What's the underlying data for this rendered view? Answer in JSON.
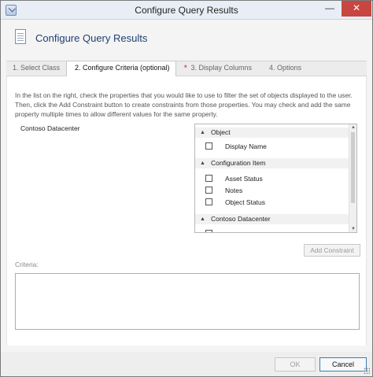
{
  "window": {
    "title": "Configure Query Results",
    "minimize_glyph": "—",
    "close_glyph": "✕"
  },
  "header": {
    "title": "Configure Query Results"
  },
  "tabs": [
    {
      "label": "1. Select Class",
      "active": false,
      "required": false
    },
    {
      "label": "2. Configure Criteria (optional)",
      "active": true,
      "required": false
    },
    {
      "label": "3. Display Columns",
      "active": false,
      "required": true
    },
    {
      "label": "4. Options",
      "active": false,
      "required": false
    }
  ],
  "content": {
    "description": "In the list on the right, check the properties that you would like to use to filter the set of objects displayed to the user. Then, click the Add Constraint button to create constraints from those properties. You may check and add the same property multiple times to allow different values for the same property.",
    "class_label": "Contoso Datacenter",
    "groups": [
      {
        "name": "Object",
        "properties": [
          {
            "label": "Display Name",
            "checked": false
          }
        ]
      },
      {
        "name": "Configuration Item",
        "properties": [
          {
            "label": "Asset Status",
            "checked": false
          },
          {
            "label": "Notes",
            "checked": false
          },
          {
            "label": "Object Status",
            "checked": false
          }
        ]
      },
      {
        "name": "Contoso Datacenter",
        "properties": []
      }
    ],
    "add_constraint_label": "Add Constraint",
    "criteria_label": "Criteria:",
    "criteria_value": ""
  },
  "footer": {
    "ok_label": "OK",
    "cancel_label": "Cancel"
  },
  "colors": {
    "accent": "#1f3f73",
    "close_button": "#c7463f",
    "required_star": "#e0463a",
    "focus_border": "#3c7fb1"
  },
  "icons": {
    "system": "window-system-icon",
    "header": "document-icon",
    "collapse": "chevron-up-icon",
    "scroll_up": "scroll-up-arrow-icon",
    "scroll_down": "scroll-down-arrow-icon",
    "grip": "resize-grip-icon"
  }
}
